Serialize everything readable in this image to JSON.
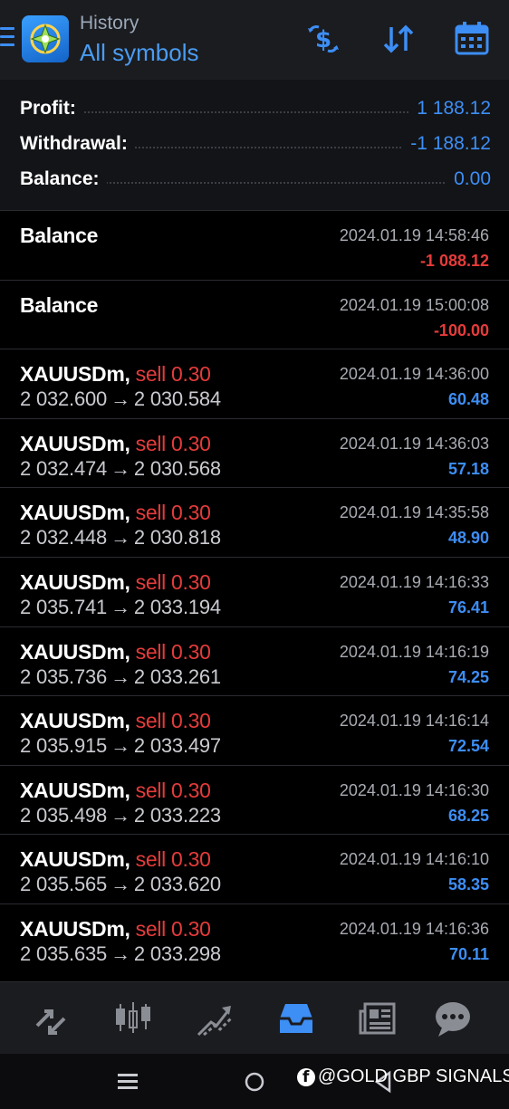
{
  "header": {
    "title": "History",
    "subtitle": "All symbols",
    "icons": [
      "menu-icon",
      "app-logo-icon",
      "currency-exchange-icon",
      "sort-icon",
      "calendar-icon"
    ]
  },
  "summary": {
    "profit_label": "Profit:",
    "profit_value": "1 188.12",
    "withdrawal_label": "Withdrawal:",
    "withdrawal_value": "-1 188.12",
    "balance_label": "Balance:",
    "balance_value": "0.00"
  },
  "deals": [
    {
      "title": "Balance",
      "side": "",
      "prices": "",
      "time": "2024.01.19 14:58:46",
      "profit": "-1 088.12",
      "negative": true
    },
    {
      "title": "Balance",
      "side": "",
      "prices": "",
      "time": "2024.01.19 15:00:08",
      "profit": "-100.00",
      "negative": true
    },
    {
      "title": "XAUUSDm,",
      "side": "sell 0.30",
      "open": "2 032.600",
      "close": "2 030.584",
      "time": "2024.01.19 14:36:00",
      "profit": "60.48"
    },
    {
      "title": "XAUUSDm,",
      "side": "sell 0.30",
      "open": "2 032.474",
      "close": "2 030.568",
      "time": "2024.01.19 14:36:03",
      "profit": "57.18"
    },
    {
      "title": "XAUUSDm,",
      "side": "sell 0.30",
      "open": "2 032.448",
      "close": "2 030.818",
      "time": "2024.01.19 14:35:58",
      "profit": "48.90"
    },
    {
      "title": "XAUUSDm,",
      "side": "sell 0.30",
      "open": "2 035.741",
      "close": "2 033.194",
      "time": "2024.01.19 14:16:33",
      "profit": "76.41"
    },
    {
      "title": "XAUUSDm,",
      "side": "sell 0.30",
      "open": "2 035.736",
      "close": "2 033.261",
      "time": "2024.01.19 14:16:19",
      "profit": "74.25"
    },
    {
      "title": "XAUUSDm,",
      "side": "sell 0.30",
      "open": "2 035.915",
      "close": "2 033.497",
      "time": "2024.01.19 14:16:14",
      "profit": "72.54"
    },
    {
      "title": "XAUUSDm,",
      "side": "sell 0.30",
      "open": "2 035.498",
      "close": "2 033.223",
      "time": "2024.01.19 14:16:30",
      "profit": "68.25"
    },
    {
      "title": "XAUUSDm,",
      "side": "sell 0.30",
      "open": "2 035.565",
      "close": "2 033.620",
      "time": "2024.01.19 14:16:10",
      "profit": "58.35"
    },
    {
      "title": "XAUUSDm,",
      "side": "sell 0.30",
      "open": "2 035.635",
      "close": "2 033.298",
      "time": "2024.01.19 14:16:36",
      "profit": "70.11"
    }
  ],
  "price_arrow": "→",
  "bottom_nav": {
    "items": [
      "quotes-icon",
      "chart-icon",
      "trade-icon",
      "history-icon",
      "news-icon",
      "chat-icon"
    ],
    "active": "history-icon"
  },
  "system_bar": {
    "icons": [
      "recents-icon",
      "home-icon",
      "back-icon"
    ]
  },
  "watermark": {
    "text": "@GOLD GBP SIGNALS"
  },
  "colors": {
    "accent": "#3d8ef5",
    "sell": "#e63b3b",
    "header_bg": "#1b1c20",
    "background": "#000000"
  }
}
